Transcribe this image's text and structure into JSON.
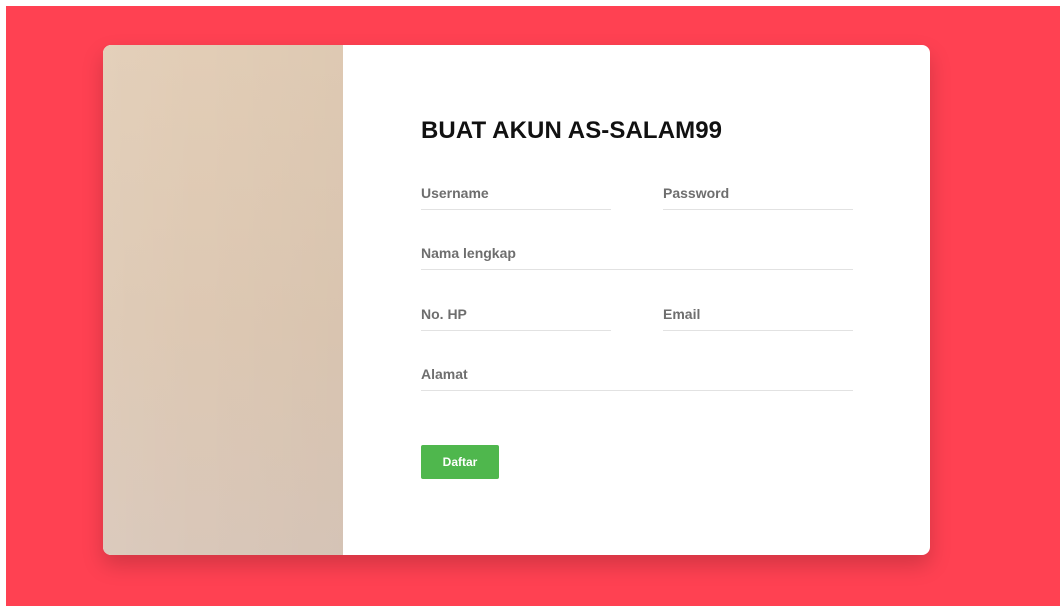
{
  "page": {
    "colors": {
      "background": "#ff4152",
      "card": "#ffffff",
      "side_image": "#e0ccb6",
      "button": "#4fb74d",
      "title": "#111111"
    }
  },
  "form": {
    "title": "BUAT AKUN AS-SALAM99",
    "fields": {
      "username": {
        "placeholder": "Username",
        "value": ""
      },
      "password": {
        "placeholder": "Password",
        "value": ""
      },
      "nama_lengkap": {
        "placeholder": "Nama lengkap",
        "value": ""
      },
      "no_hp": {
        "placeholder": "No. HP",
        "value": ""
      },
      "email": {
        "placeholder": "Email",
        "value": ""
      },
      "alamat": {
        "placeholder": "Alamat",
        "value": ""
      }
    },
    "submit_label": "Daftar"
  }
}
